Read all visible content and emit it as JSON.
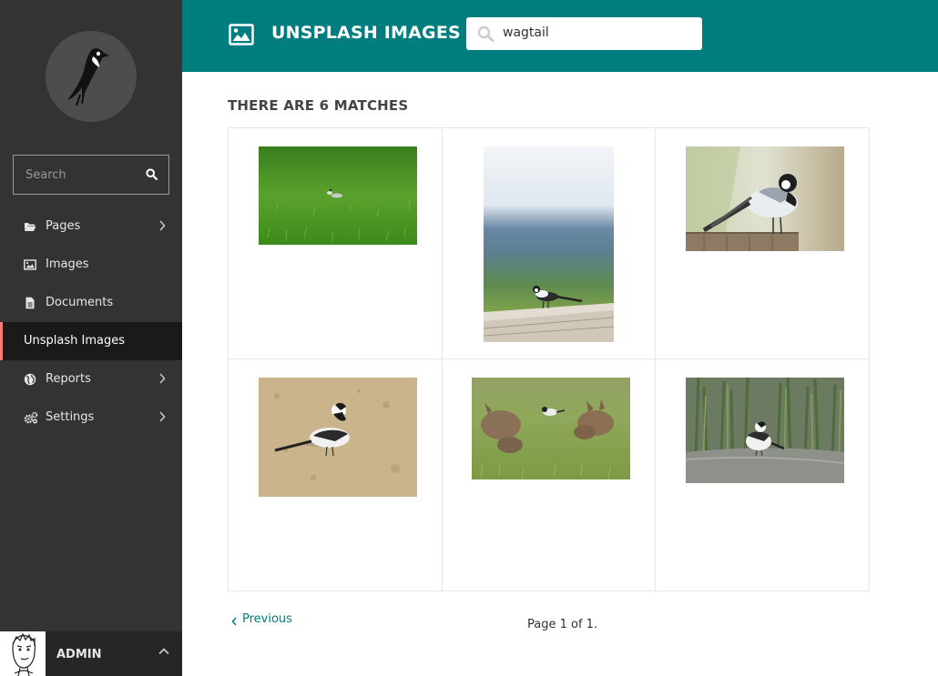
{
  "sidebar": {
    "search_placeholder": "Search",
    "items": [
      {
        "label": "Pages",
        "icon": "folder-open-icon"
      },
      {
        "label": "Images",
        "icon": "image-icon"
      },
      {
        "label": "Documents",
        "icon": "document-icon"
      },
      {
        "label": "Unsplash Images",
        "icon": ""
      },
      {
        "label": "Reports",
        "icon": "globe-icon"
      },
      {
        "label": "Settings",
        "icon": "cogs-icon"
      }
    ],
    "account": {
      "name": "ADMIN"
    }
  },
  "header": {
    "title": "UNSPLASH IMAGES",
    "search_value": "wagtail",
    "icon": "image-icon"
  },
  "results": {
    "count_text": "THERE ARE 6 MATCHES",
    "images": [
      {
        "description": "wagtail on green grass"
      },
      {
        "description": "wagtail on wooden fence"
      },
      {
        "description": "wagtail on tree stump"
      },
      {
        "description": "wagtail on sand"
      },
      {
        "description": "wagtail with wallabies"
      },
      {
        "description": "wagtail by reeds"
      }
    ]
  },
  "pagination": {
    "previous_label": "Previous",
    "page_info": "Page 1 of 1."
  },
  "colors": {
    "header": "#007d7e",
    "sidebar": "#333333",
    "active_item": "#1a1a1a",
    "accent": "#f37e77"
  }
}
